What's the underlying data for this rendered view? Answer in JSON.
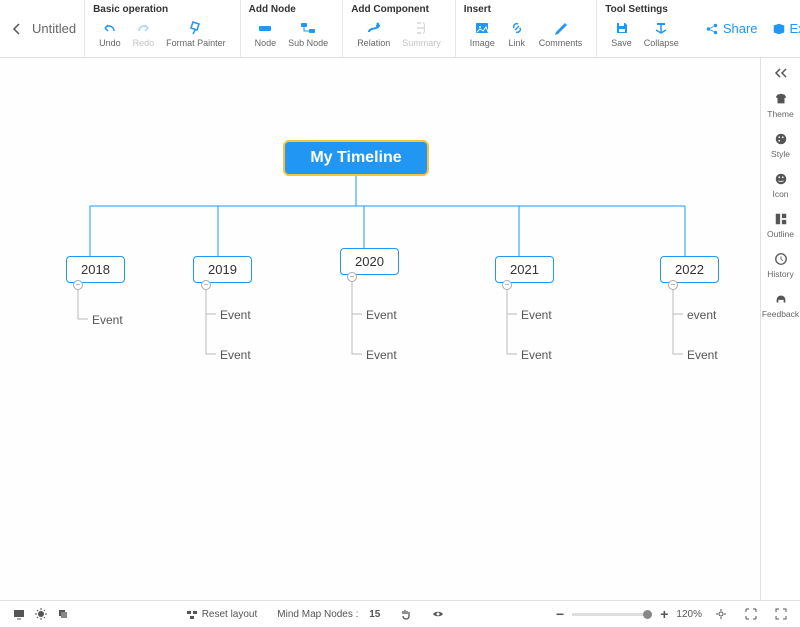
{
  "header": {
    "title": "Untitled",
    "groups": {
      "basic": {
        "label": "Basic operation",
        "undo": "Undo",
        "redo": "Redo",
        "format": "Format Painter"
      },
      "addnode": {
        "label": "Add Node",
        "node": "Node",
        "subnode": "Sub Node"
      },
      "addcomp": {
        "label": "Add Component",
        "relation": "Relation",
        "summary": "Summary"
      },
      "insert": {
        "label": "Insert",
        "image": "Image",
        "link": "Link",
        "comments": "Comments"
      },
      "tool": {
        "label": "Tool Settings",
        "save": "Save",
        "collapse": "Collapse"
      }
    },
    "share": "Share",
    "export": "Export"
  },
  "right": {
    "theme": "Theme",
    "style": "Style",
    "icon": "Icon",
    "outline": "Outline",
    "history": "History",
    "feedback": "Feedback"
  },
  "mindmap": {
    "root": "My Timeline",
    "years": [
      {
        "label": "2018",
        "events": [
          "Event"
        ]
      },
      {
        "label": "2019",
        "events": [
          "Event",
          "Event"
        ]
      },
      {
        "label": "2020",
        "events": [
          "Event",
          "Event"
        ]
      },
      {
        "label": "2021",
        "events": [
          "Event",
          "Event"
        ]
      },
      {
        "label": "2022",
        "events": [
          "event",
          "Event"
        ]
      }
    ]
  },
  "status": {
    "reset": "Reset layout",
    "nodes_label": "Mind Map Nodes :",
    "nodes_count": "15",
    "zoom": "120%"
  }
}
